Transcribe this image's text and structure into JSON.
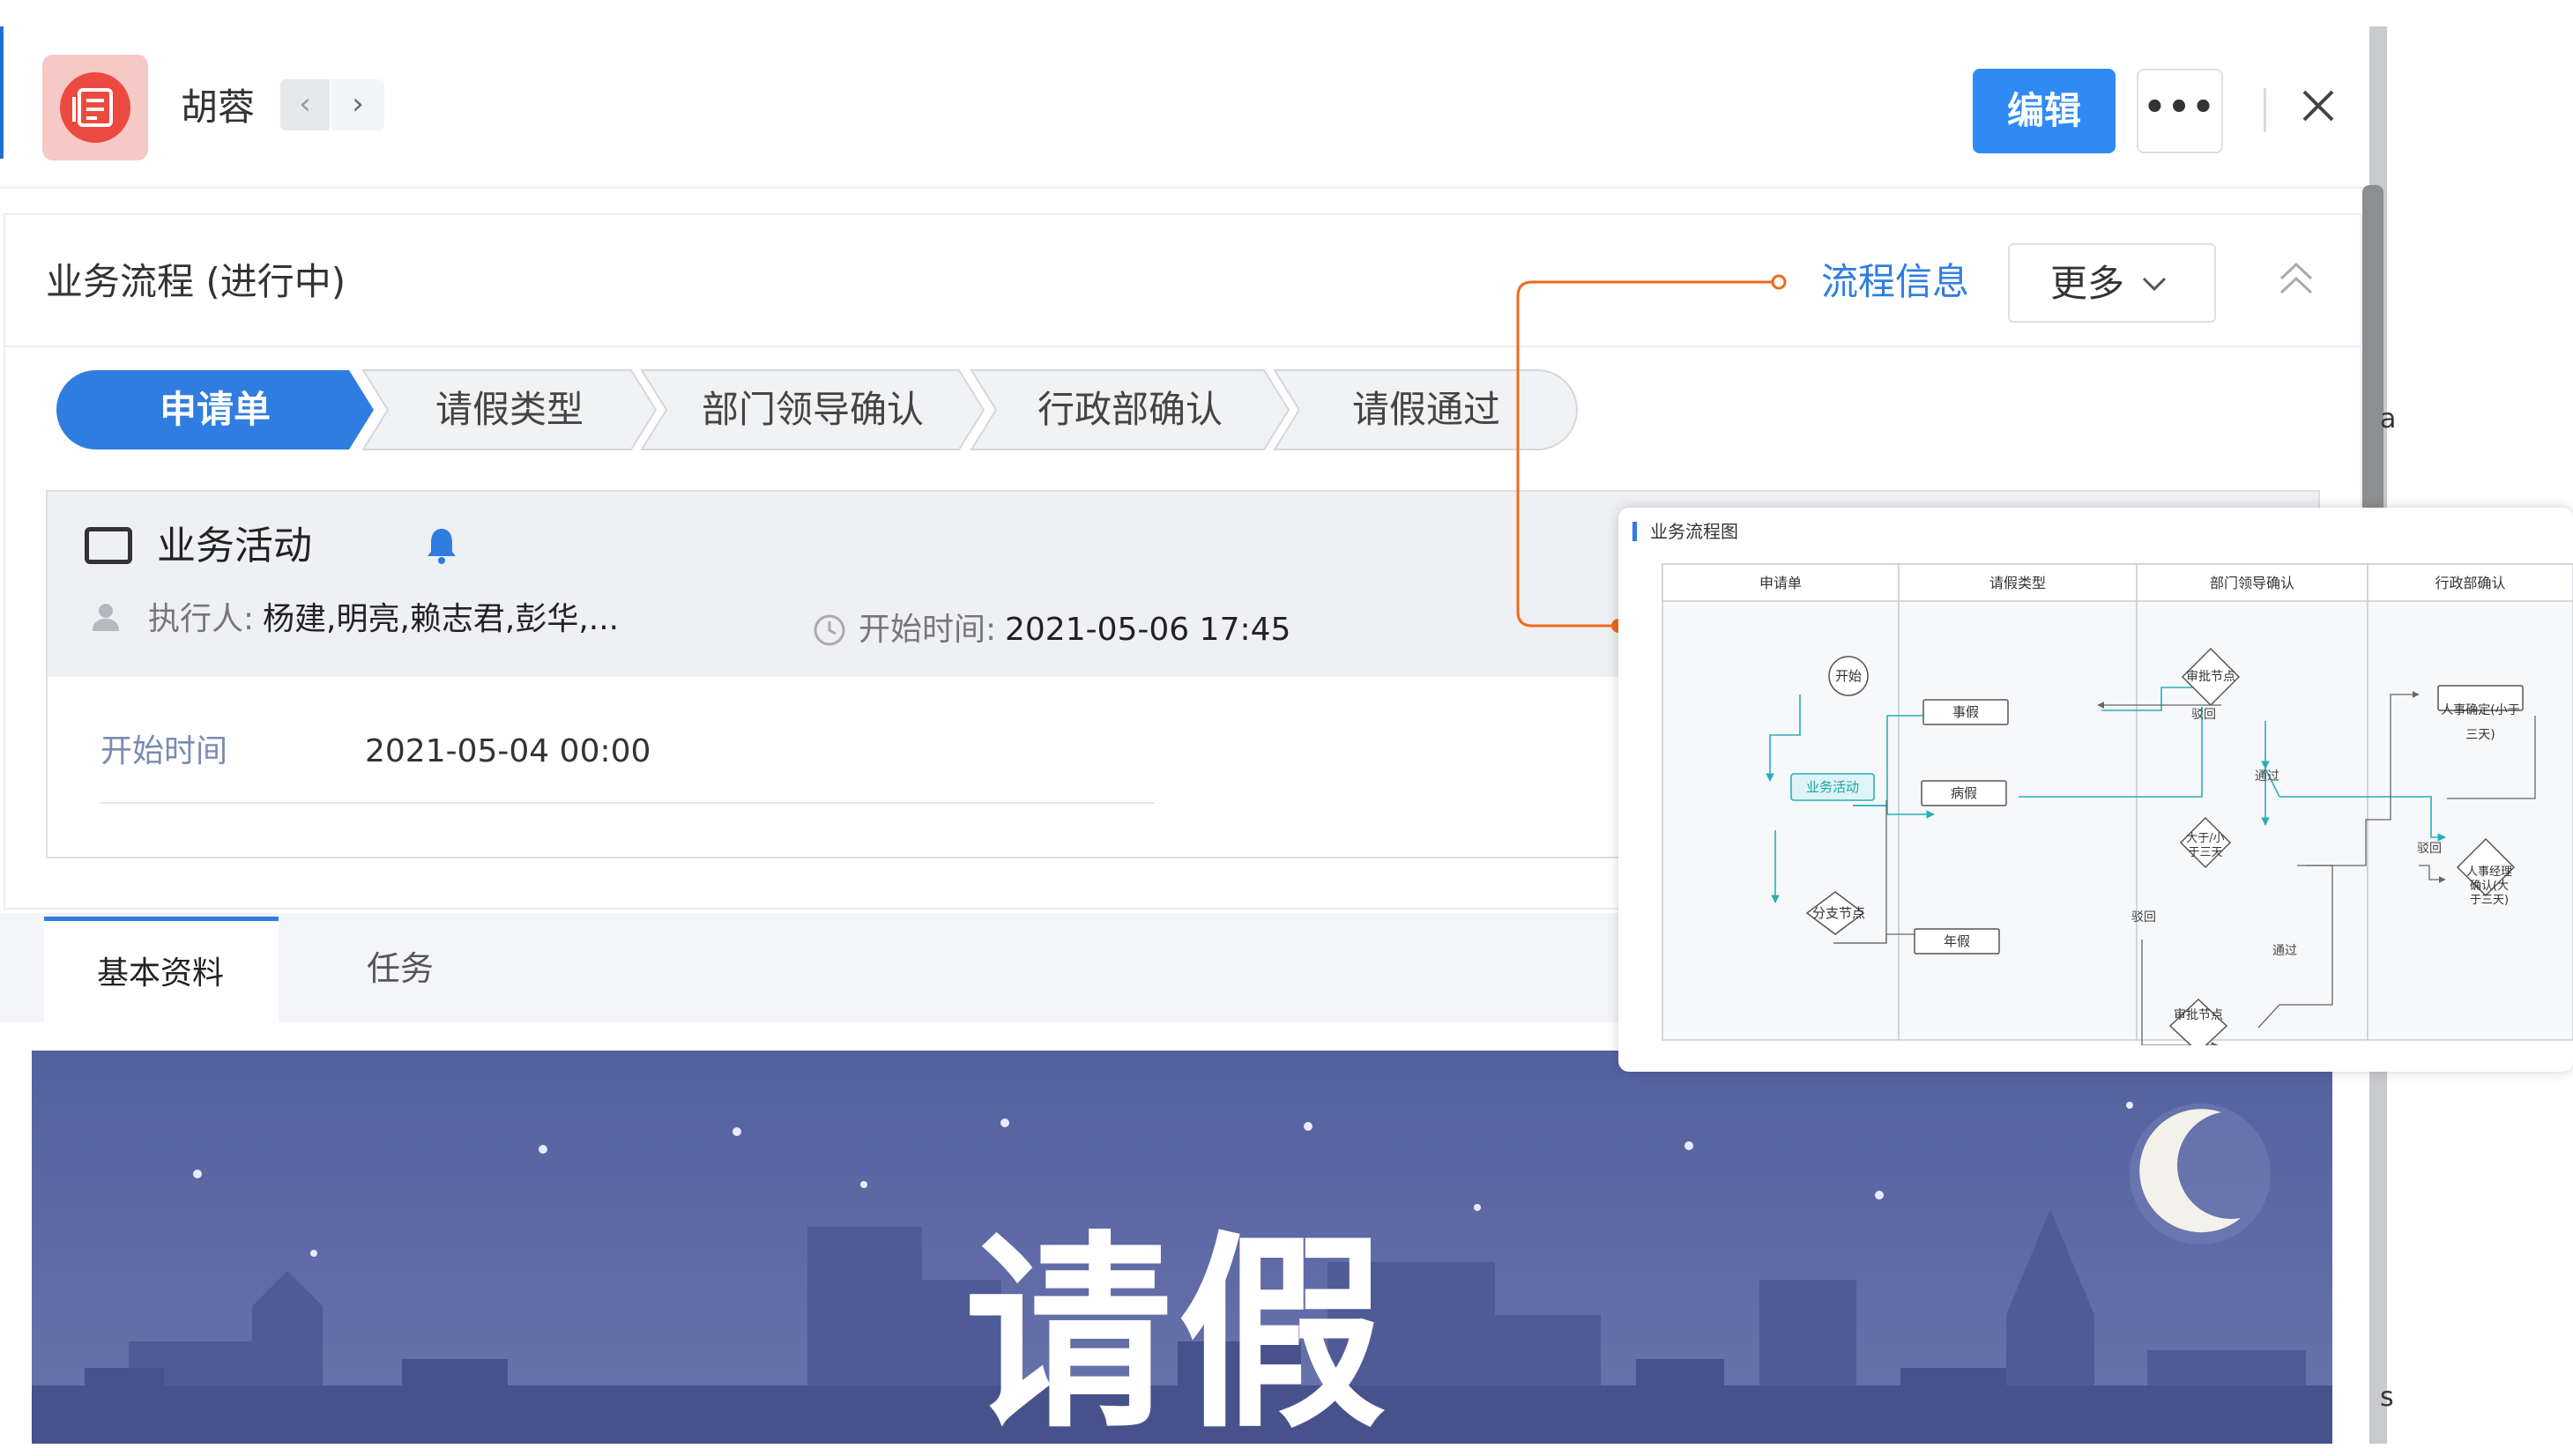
{
  "header": {
    "user_name": "胡蓉",
    "nav_prev": "‹",
    "nav_next": "›",
    "edit_label": "编辑",
    "more_dots": "•••",
    "close_icon": "close-icon",
    "avatar_icon": "leave-form-icon",
    "avatar_color": "#ec4a40",
    "accent": "#2f8bf3"
  },
  "process": {
    "title": "业务流程 (进行中)",
    "info_link": "流程信息",
    "more_label": "更多",
    "steps": [
      {
        "label": "申请单",
        "active": true
      },
      {
        "label": "请假类型",
        "active": false
      },
      {
        "label": "部门领导确认",
        "active": false
      },
      {
        "label": "行政部确认",
        "active": false
      },
      {
        "label": "请假通过",
        "active": false
      }
    ]
  },
  "activity": {
    "title": "业务活动",
    "executor_label": "执行人:",
    "executor_value": "杨建,明亮,赖志君,彭华,...",
    "start_label_1": "开始时间:",
    "start_value_1": "2021-05-06 17:45",
    "start_label_2": "开始时间",
    "start_value_2": "2021-05-04 00:00"
  },
  "tabs": [
    {
      "label": "基本资料",
      "active": true
    },
    {
      "label": "任务",
      "active": false
    }
  ],
  "banner": {
    "title": "请假"
  },
  "flowchart": {
    "title": "业务流程图",
    "lanes": [
      "申请单",
      "请假类型",
      "部门领导确认",
      "行政部确认"
    ],
    "nodes": {
      "start": "开始",
      "activity": "业务活动",
      "branch": "分支节点",
      "personal": "事假",
      "sick": "病假",
      "annual": "年假",
      "approve1": "审批节点",
      "compare": "大于/小于三天",
      "approve2": "审批节点",
      "hr_confirm": "人事确定(小于三天)",
      "hr_manager": "人事经理确认(大于三天)"
    },
    "edges": {
      "reject1": "驳回",
      "pass1": "通过",
      "reject2": "驳回",
      "reject3": "驳回",
      "pass2": "通过"
    }
  },
  "stray_text": [
    "a",
    ":",
    "s"
  ]
}
